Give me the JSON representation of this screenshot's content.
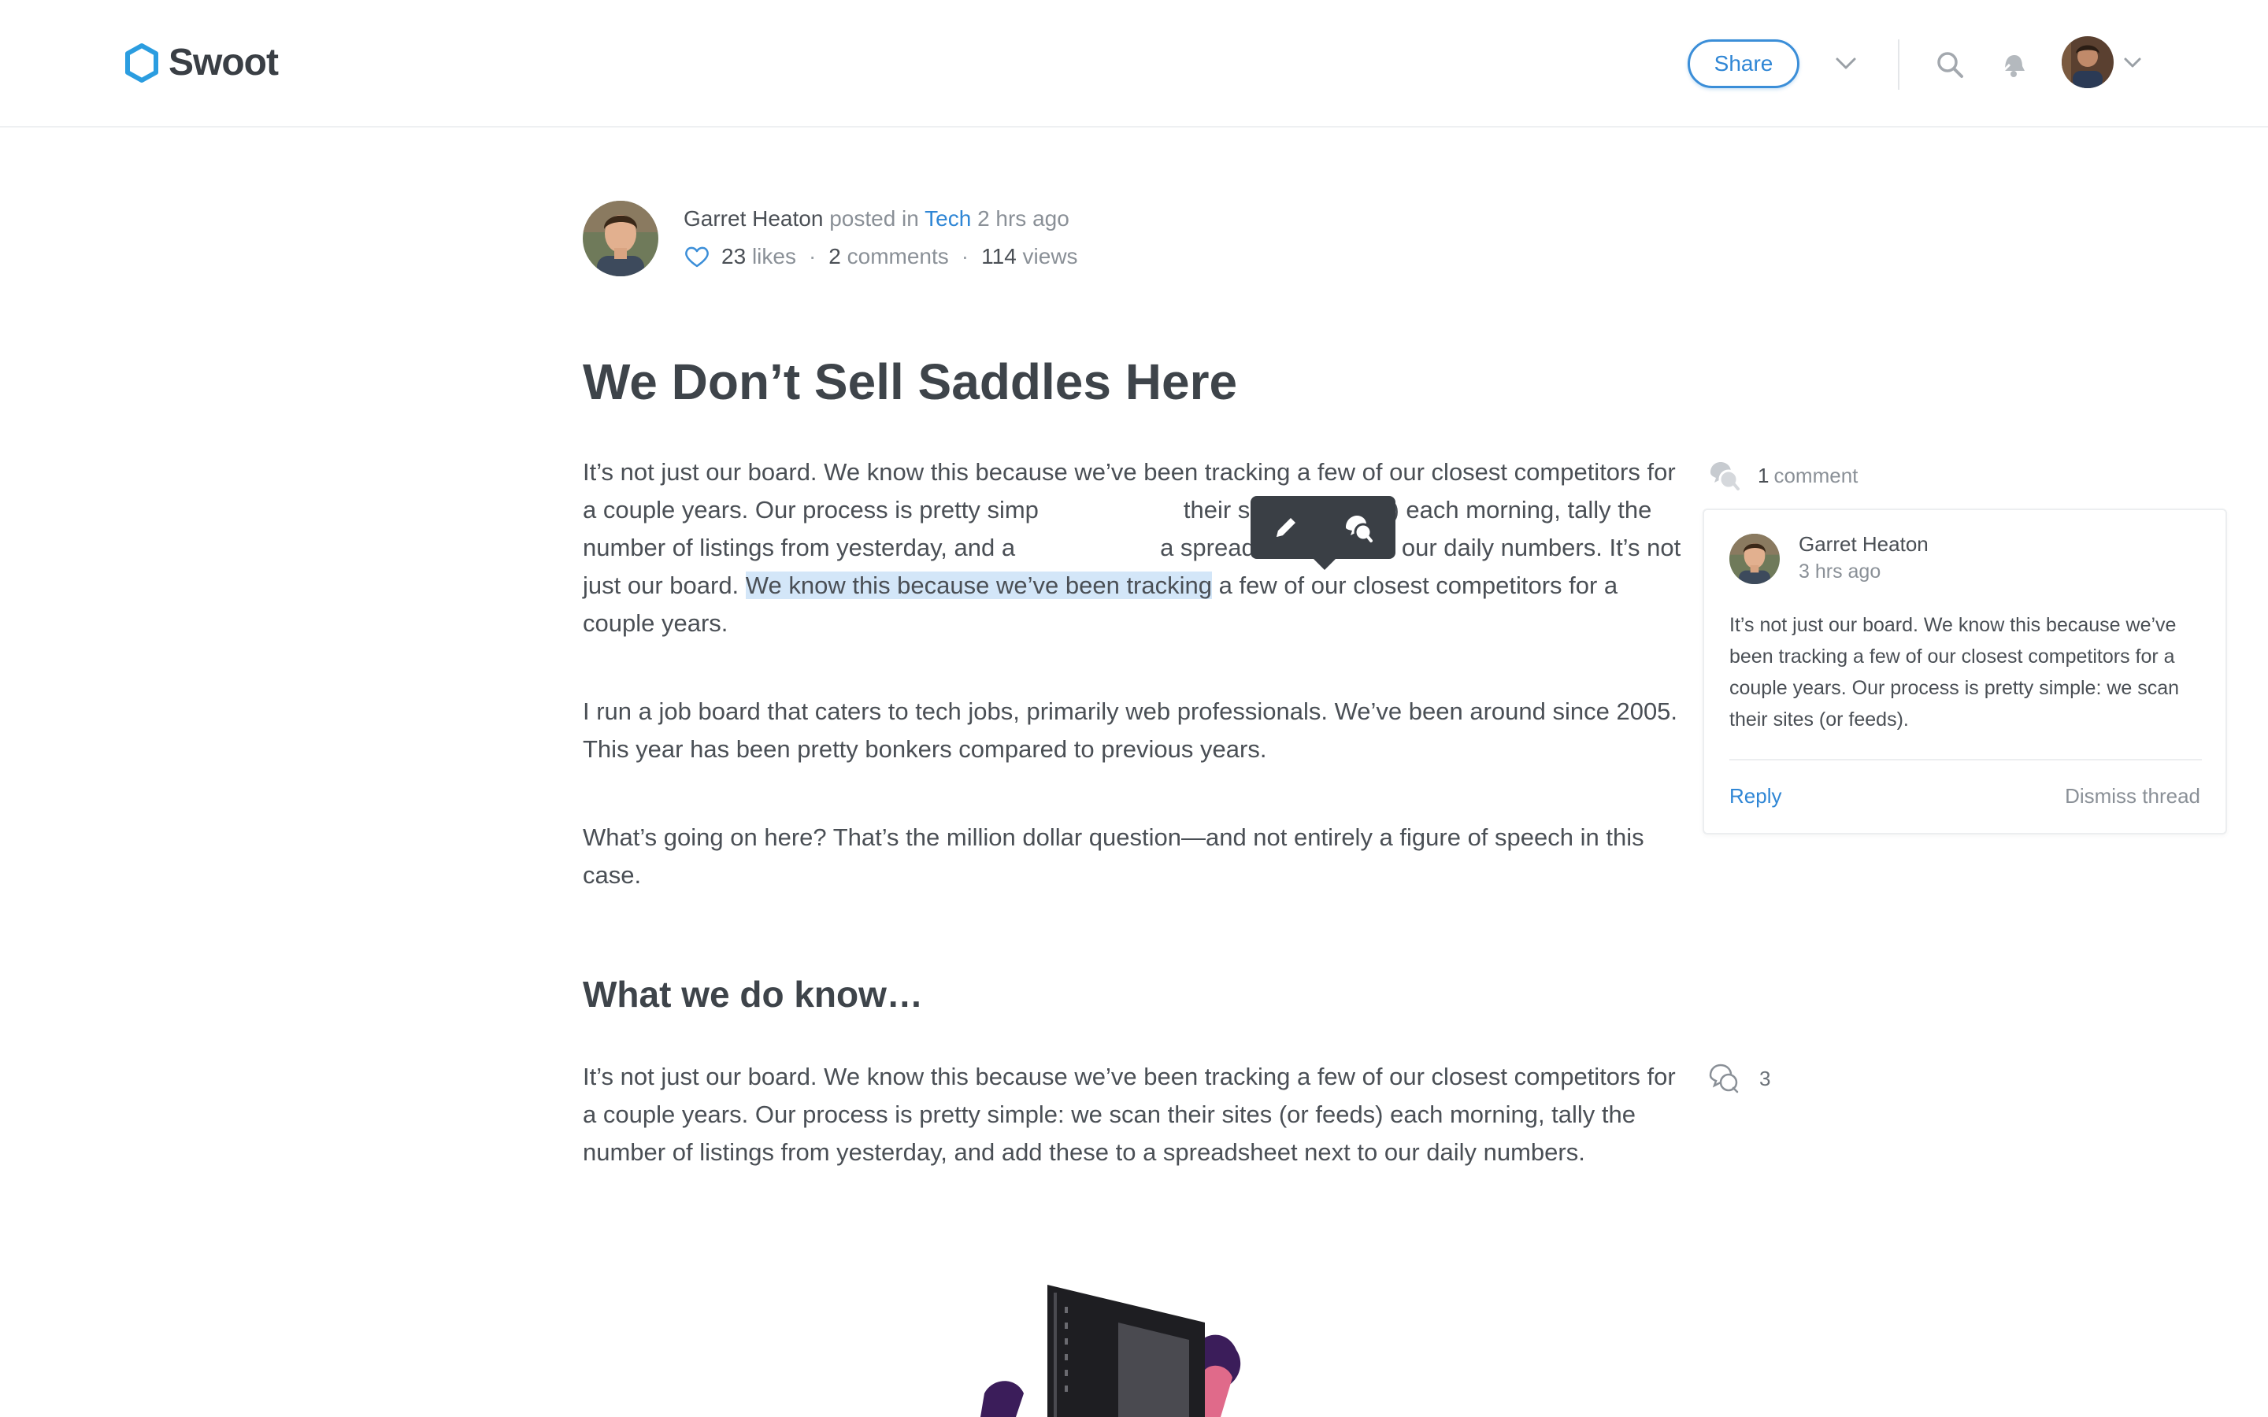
{
  "header": {
    "logo_text": "Swoot",
    "share_label": "Share",
    "icons": [
      "logo-hexagon-icon",
      "chevron-down-icon",
      "search-icon",
      "bell-icon",
      "avatar",
      "chevron-down-icon"
    ]
  },
  "post": {
    "author": "Garret Heaton",
    "posted_in_text": "posted in",
    "category": "Tech",
    "time_ago": "2 hrs ago",
    "likes_count": "23",
    "likes_label": "likes",
    "comments_count": "2",
    "comments_label": "comments",
    "views_count": "114",
    "views_label": "views",
    "title": "We Don’t Sell Saddles Here",
    "p1_a": "It’s not just our board. We know this because we’ve been tracking a few of our closest competitors for a couple years. Our process is pretty simp",
    "p1_b": "their sites (or feeds) each morning, tally the number of listings from yesterday, and a",
    "p1_c": "a spreadsheet next to our daily numbers. It’s not just our board. ",
    "p1_highlight": "We know this because we’ve been tracking",
    "p1_d": " a few of our closest competitors for a couple years.",
    "p2": "I run a job board that caters to tech jobs, primarily web professionals. We’ve been around since 2005. This year has been pretty bonkers compared to previous years.",
    "p3": "What’s going on here? That’s the million dollar question—and not entirely a figure of speech in this case.",
    "h2": "What we do know…",
    "p4": "It’s not just our board. We know this because we’ve been tracking a few of our closest competitors for a couple years. Our process is pretty simple: we scan their sites (or feeds) each morning, tally the number of listings from yesterday, and add these to a spreadsheet next to our daily numbers."
  },
  "toolbar": {
    "icons": [
      "pencil-icon",
      "comment-icon"
    ]
  },
  "thread": {
    "count": "1",
    "count_label": "comment",
    "author": "Garret Heaton",
    "time": "3 hrs ago",
    "body": "It’s not just our board. We know this because we’ve been tracking a few of our closest competitors for a couple years. Our process is pretty simple: we scan their sites (or feeds).",
    "reply_label": "Reply",
    "dismiss_label": "Dismiss thread"
  },
  "thread2": {
    "count": "3"
  },
  "colors": {
    "accent": "#2f86d5",
    "highlight": "#d3e6f8",
    "text": "#4a4f55",
    "muted": "#8a9097",
    "toolbar_bg": "#3a3f45"
  }
}
